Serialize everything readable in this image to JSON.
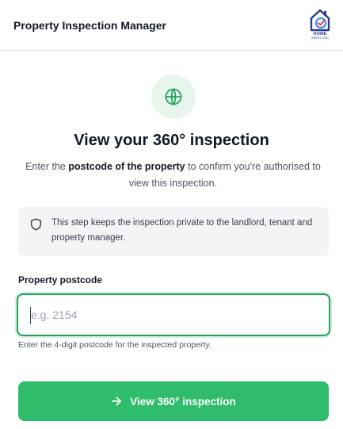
{
  "header": {
    "title": "Property Inspection Manager",
    "logo_text": "HOME",
    "logo_subtext": "INSPECTION",
    "logo_icon": "house-check-icon"
  },
  "hero": {
    "icon": "globe-icon",
    "heading": "View your 360° inspection",
    "sub_prefix": "Enter the ",
    "sub_bold": "postcode of the property",
    "sub_suffix": " to confirm you're authorised to view this inspection."
  },
  "privacy": {
    "icon": "shield-icon",
    "text": "This step keeps the inspection private to the landlord, tenant and property manager."
  },
  "form": {
    "label": "Property postcode",
    "placeholder": "e.g. 2154",
    "value": "",
    "hint": "Enter the 4-digit postcode for the inspected property."
  },
  "submit": {
    "icon": "arrow-right-icon",
    "label": "View 360° inspection"
  },
  "colors": {
    "accent": "#2fbd6b",
    "focus_border": "#22a55a",
    "brand": "#2e3a8c"
  }
}
